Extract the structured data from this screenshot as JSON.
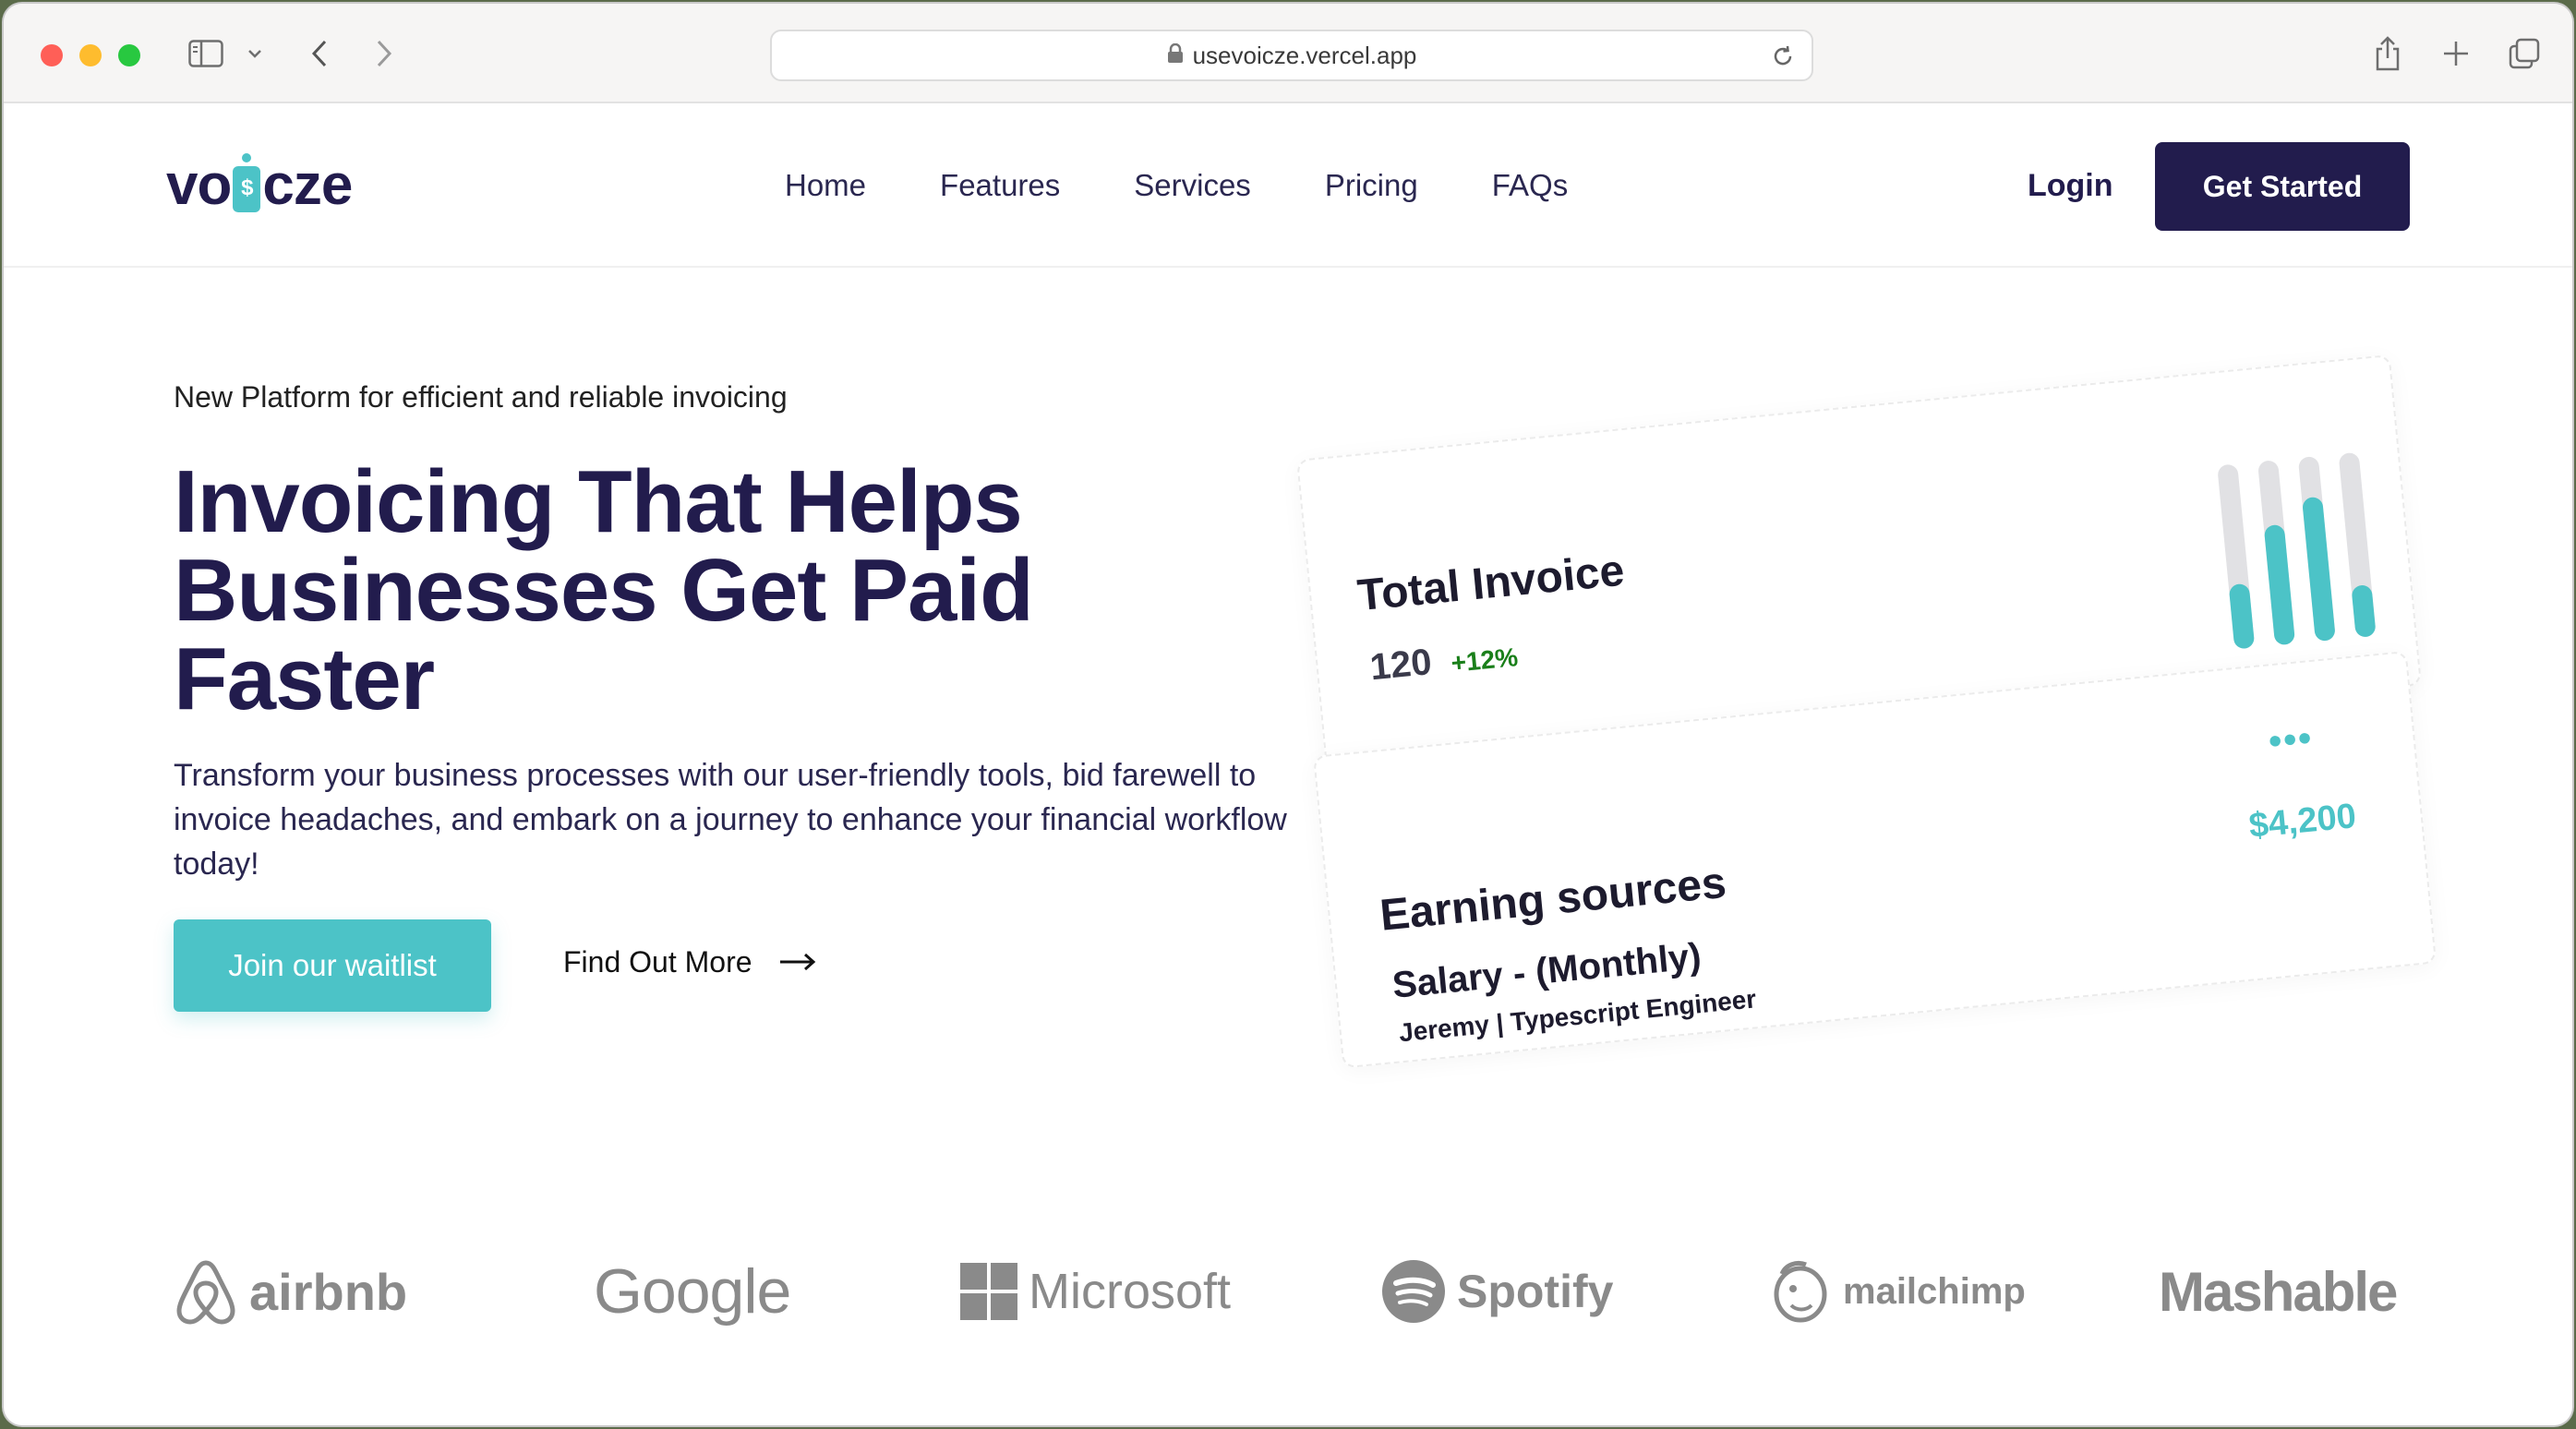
{
  "browser": {
    "url": "usevoicze.vercel.app"
  },
  "header": {
    "logo_text_left": "vo",
    "logo_mark_letter": "$",
    "logo_text_right": "cze",
    "nav": [
      "Home",
      "Features",
      "Services",
      "Pricing",
      "FAQs"
    ],
    "login_label": "Login",
    "cta_label": "Get Started"
  },
  "hero": {
    "tagline": "New Platform for efficient and reliable invoicing",
    "headline_lines": [
      "Invoicing That Helps",
      "Businesses Get Paid",
      "Faster"
    ],
    "subtext": "Transform your business processes with our user-friendly tools, bid farewell to invoice headaches, and embark on a journey to enhance your financial workflow today!",
    "waitlist_label": "Join our waitlist",
    "findout_label": "Find Out More"
  },
  "cards": {
    "total_invoice": {
      "title": "Total Invoice",
      "value": "120",
      "change": "+12%",
      "bar_levels": [
        0.35,
        0.65,
        0.78,
        0.28
      ]
    },
    "earning_sources": {
      "title": "Earning sources",
      "item_title": "Salary - (Monthly)",
      "item_sub": "Jeremy | Typescript Engineer",
      "amount": "$4,200",
      "menu": "•••"
    }
  },
  "logos": [
    "airbnb",
    "Google",
    "Microsoft",
    "Spotify",
    "mailchimp",
    "Mashable"
  ],
  "colors": {
    "brand_dark": "#221c4d",
    "accent": "#4cc3c7",
    "positive": "#1a7f1a"
  }
}
